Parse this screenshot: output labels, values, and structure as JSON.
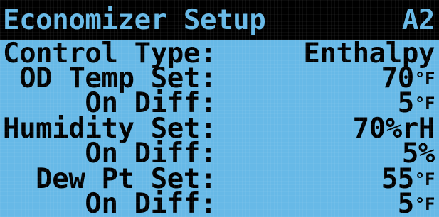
{
  "screen": {
    "title": "Economizer Setup",
    "screen_code": "A2",
    "rows": [
      {
        "label": "Control Type:",
        "value": "Enthalpy"
      },
      {
        "label": " OD Temp Set:",
        "value": "70",
        "unit": "°F"
      },
      {
        "label": "     On Diff:",
        "value": "5",
        "unit": "°F"
      },
      {
        "label": "Humidity Set:",
        "value": "70%rH"
      },
      {
        "label": "     On Diff:",
        "value": "5%"
      },
      {
        "label": "  Dew Pt Set:",
        "value": "55",
        "unit": "°F"
      },
      {
        "label": "     On Diff:",
        "value": "5",
        "unit": "°F"
      }
    ]
  },
  "colors": {
    "screen_background": "#67b9e7",
    "text": "#000000",
    "title_background": "#000000"
  }
}
